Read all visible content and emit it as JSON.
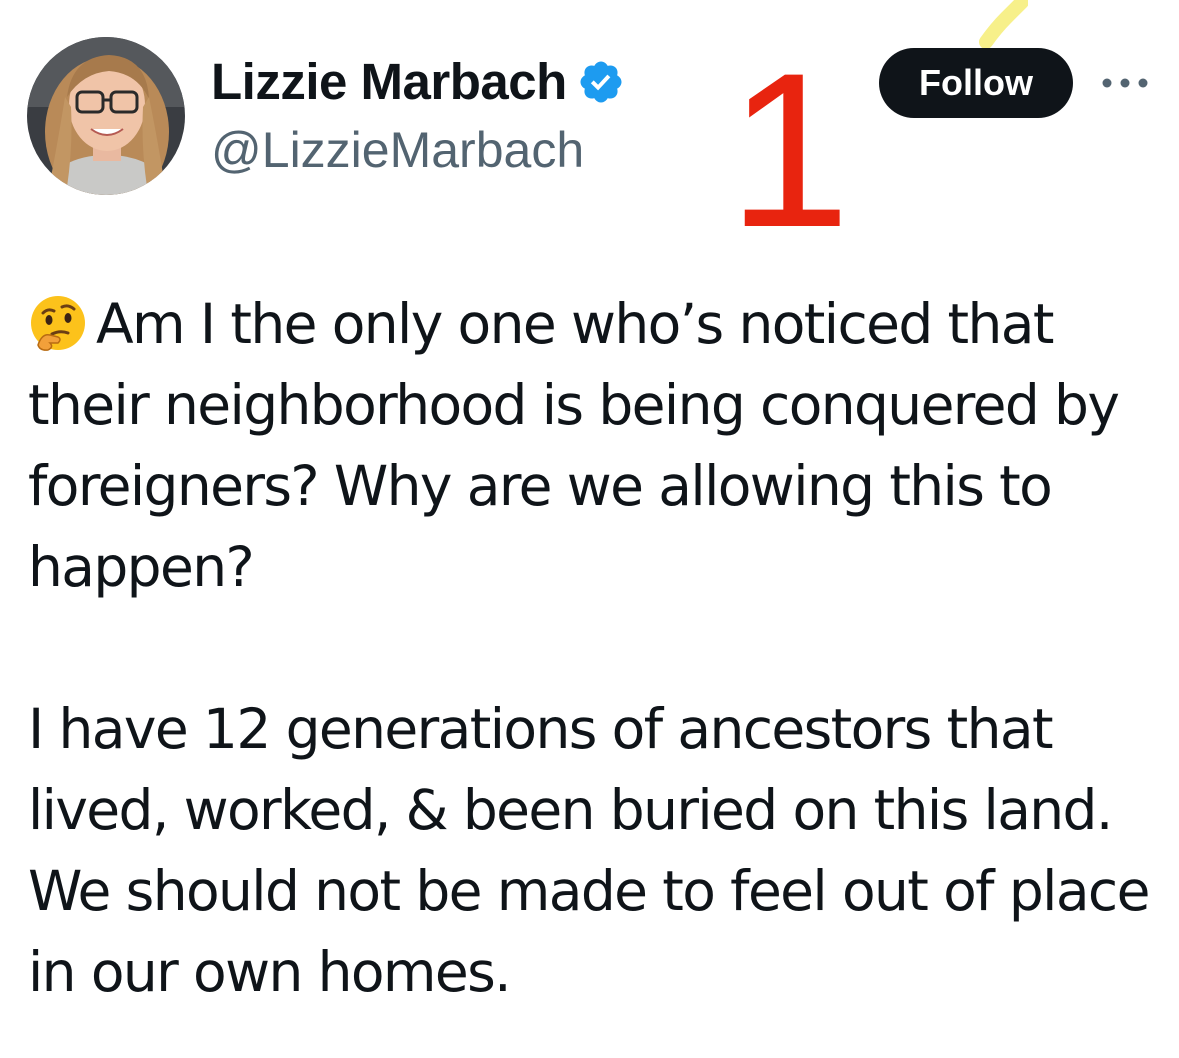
{
  "author": {
    "display_name": "Lizzie Marbach",
    "handle": "@LizzieMarbach",
    "verified": true,
    "avatar_icon": "profile-photo-woman-glasses"
  },
  "annotation": {
    "number": "1",
    "color": "#e8240f"
  },
  "actions": {
    "follow_label": "Follow",
    "more_icon": "ellipsis-icon"
  },
  "tweet": {
    "emoji_icon": "thinking-face-emoji",
    "paragraph_1": "Am I the only one who’s noticed that their neighborhood is being conquered by foreigners? Why are we allowing this to happen?",
    "paragraph_2": "I have 12 generations of ancestors that lived, worked, & been buried on this land. We should not be made to feel out of place in our own homes."
  },
  "colors": {
    "text_primary": "#0f1419",
    "text_secondary": "#536471",
    "verified_blue": "#1d9bf0",
    "follow_bg": "#0f1419"
  }
}
